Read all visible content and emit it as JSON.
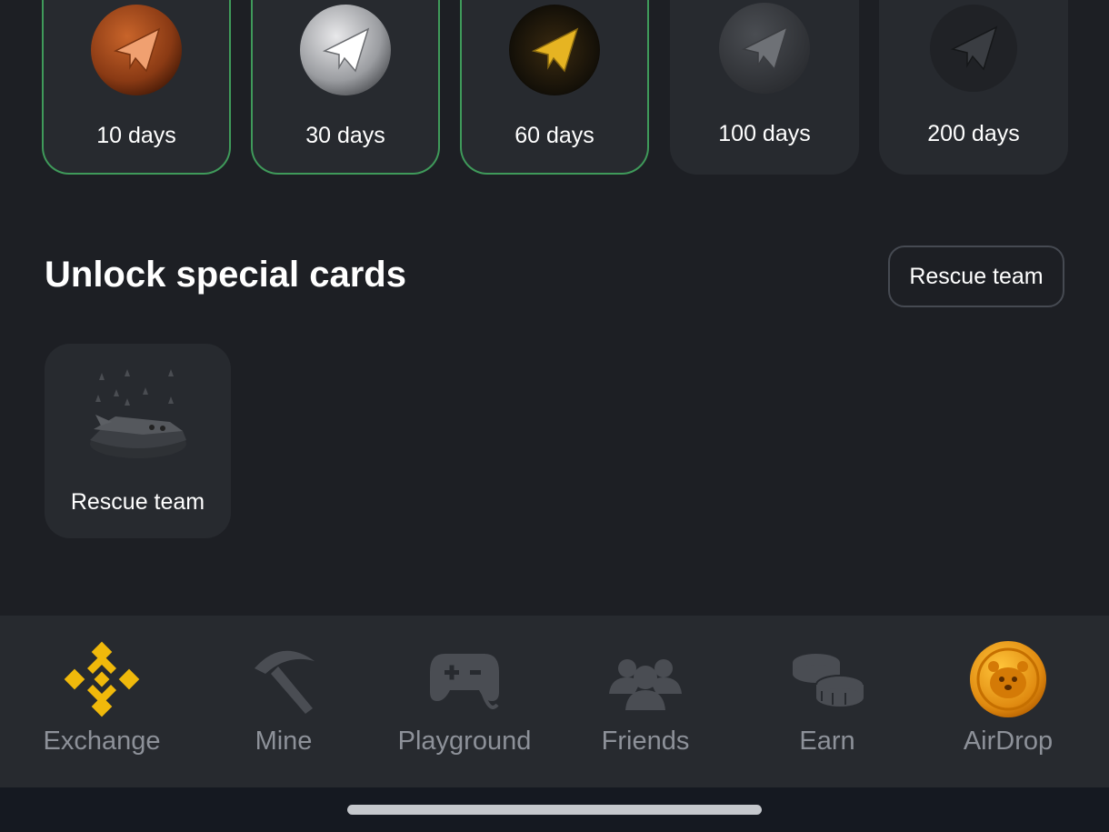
{
  "streak": {
    "items": [
      {
        "label": "10 days",
        "icon": "bronze-paper-plane-badge",
        "active": true
      },
      {
        "label": "30 days",
        "icon": "silver-paper-plane-badge",
        "active": true
      },
      {
        "label": "60 days",
        "icon": "gold-paper-plane-badge",
        "active": true
      },
      {
        "label": "100 days",
        "icon": "platinum-paper-plane-badge",
        "active": false
      },
      {
        "label": "200 days",
        "icon": "black-paper-plane-badge",
        "active": false
      }
    ]
  },
  "special": {
    "title": "Unlock special cards",
    "filter_label": "Rescue team",
    "cards": [
      {
        "label": "Rescue team",
        "icon": "rescue-spaceship-icon"
      }
    ]
  },
  "tabs": [
    {
      "label": "Exchange",
      "icon": "binance-logo-icon",
      "color": "#f0b90b"
    },
    {
      "label": "Mine",
      "icon": "pickaxe-icon",
      "color": "#4a4d53"
    },
    {
      "label": "Playground",
      "icon": "gamepad-icon",
      "color": "#4a4d53"
    },
    {
      "label": "Friends",
      "icon": "friends-icon",
      "color": "#4a4d53"
    },
    {
      "label": "Earn",
      "icon": "coins-icon",
      "color": "#4a4d53"
    },
    {
      "label": "AirDrop",
      "icon": "hamster-coin-icon",
      "color": "#e89a14"
    }
  ],
  "colors": {
    "background": "#1d1f24",
    "card": "#272a2f",
    "active_border": "#3f9a5a",
    "tab_label": "#8d9199"
  }
}
